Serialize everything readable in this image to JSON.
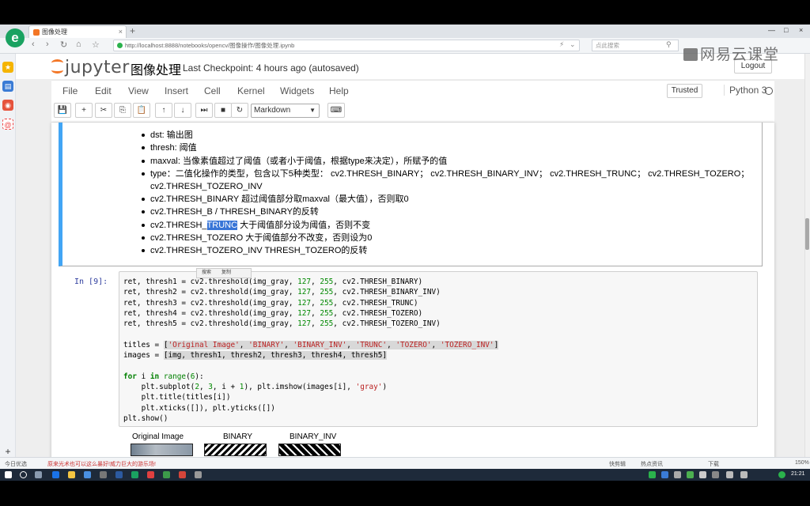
{
  "browser": {
    "logo": "e",
    "tab_title": "图像处理",
    "tab_close": "×",
    "new_tab": "+",
    "window_controls": [
      "—",
      "□",
      "×"
    ],
    "url_host": "http://localhost:8888",
    "url_path": "/notebooks/opencv/图像操作/图像处理.ipynb",
    "search_placeholder": "点此搜索",
    "nav": {
      "back": "‹",
      "forward": "›",
      "reload": "↻",
      "home": "⌂",
      "star": "☆"
    }
  },
  "watermark": "网易云课堂",
  "jupyter": {
    "logo_text": "jupyter",
    "notebook_name": "图像处理",
    "checkpoint": "Last Checkpoint: 4 hours ago (autosaved)",
    "logout": "Logout",
    "menu": [
      "File",
      "Edit",
      "View",
      "Insert",
      "Cell",
      "Kernel",
      "Widgets",
      "Help"
    ],
    "trusted": "Trusted",
    "kernel": "Python 3",
    "toolbar": {
      "buttons": [
        "💾",
        "+",
        "✂",
        "⎘",
        "📋",
        "↑",
        "↓",
        "⏭",
        "■",
        "↻",
        "⌨"
      ],
      "cell_type": "Markdown"
    }
  },
  "markdown": {
    "lines": [
      {
        "text": "",
        "bullet": false
      },
      {
        "text": "dst:  输出图",
        "bullet": true
      },
      {
        "text": "thresh:  阈值",
        "bullet": true
      },
      {
        "text": "maxval:  当像素值超过了阈值（或者小于阈值，根据type来决定），所赋予的值",
        "bullet": true
      },
      {
        "text": "type：二值化操作的类型，包含以下5种类型： cv2.THRESH_BINARY； cv2.THRESH_BINARY_INV； cv2.THRESH_TRUNC； cv2.THRESH_TOZERO；",
        "bullet": true
      },
      {
        "text": "cv2.THRESH_TOZERO_INV",
        "bullet": false
      },
      {
        "text": "cv2.THRESH_BINARY 超过阈值部分取maxval（最大值），否则取0",
        "bullet": true
      },
      {
        "text": "cv2.THRESH_B        / THRESH_BINARY的反转",
        "bullet": true
      },
      {
        "pre": "cv2.THRESH_",
        "sel": "TRUNC",
        "post": " 大于阈值部分设为阈值，否则不变",
        "bullet": true
      },
      {
        "text": "cv2.THRESH_TOZERO 大于阈值部分不改变，否则设为0",
        "bullet": true
      },
      {
        "text": "cv2.THRESH_TOZERO_INV THRESH_TOZERO的反转",
        "bullet": true
      }
    ],
    "popup": [
      "搜索",
      "复制"
    ]
  },
  "code_cell": {
    "prompt": "In [9]:",
    "lines": [
      "ret, thresh1 = cv2.threshold(img_gray, 127, 255, cv2.THRESH_BINARY)",
      "ret, thresh2 = cv2.threshold(img_gray, 127, 255, cv2.THRESH_BINARY_INV)",
      "ret, thresh3 = cv2.threshold(img_gray, 127, 255, cv2.THRESH_TRUNC)",
      "ret, thresh4 = cv2.threshold(img_gray, 127, 255, cv2.THRESH_TOZERO)",
      "ret, thresh5 = cv2.threshold(img_gray, 127, 255, cv2.THRESH_TOZERO_INV)",
      "",
      "titles = ['Original Image', 'BINARY', 'BINARY_INV', 'TRUNC', 'TOZERO', 'TOZERO_INV']",
      "images = [img, thresh1, thresh2, thresh3, thresh4, thresh5]",
      "",
      "for i in range(6):",
      "    plt.subplot(2, 3, i + 1), plt.imshow(images[i], 'gray')",
      "    plt.title(titles[i])",
      "    plt.xticks([]), plt.yticks([])",
      "plt.show()"
    ]
  },
  "output": {
    "titles": [
      "Original Image",
      "BINARY",
      "BINARY_INV"
    ]
  },
  "statusbar": {
    "left": "今日优选",
    "news": "原来光术也可以这么暴好!威力巨大的游乐场!",
    "items": [
      "快剪辑",
      "热点资讯",
      "下载",
      "150%"
    ]
  },
  "taskbar": {
    "clock": "21:21"
  }
}
